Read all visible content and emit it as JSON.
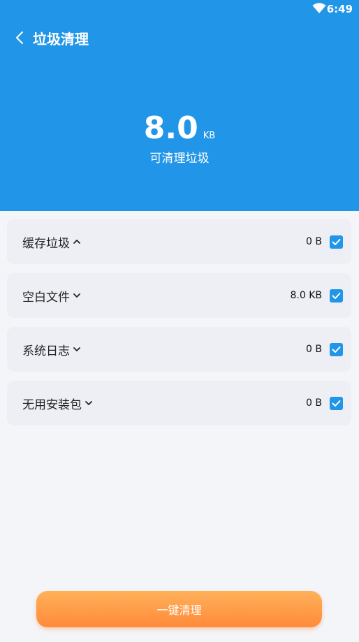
{
  "status_bar": {
    "time": "6:49",
    "wifi_icon": "wifi-icon"
  },
  "nav": {
    "back_icon": "chevron-left-icon",
    "title": "垃圾清理"
  },
  "summary": {
    "size_value": "8.0",
    "size_unit": "KB",
    "label": "可清理垃圾"
  },
  "items": [
    {
      "label": "缓存垃圾",
      "expanded": true,
      "size": "0 B",
      "checked": true
    },
    {
      "label": "空白文件",
      "expanded": false,
      "size": "8.0 KB",
      "checked": true
    },
    {
      "label": "系统日志",
      "expanded": false,
      "size": "0 B",
      "checked": true
    },
    {
      "label": "无用安装包",
      "expanded": false,
      "size": "0 B",
      "checked": true
    }
  ],
  "action": {
    "clean_label": "一键清理"
  },
  "colors": {
    "primary": "#2196e8",
    "button_top": "#ffb15a",
    "button_bottom": "#ff8a3a",
    "background": "#f4f5f9"
  }
}
